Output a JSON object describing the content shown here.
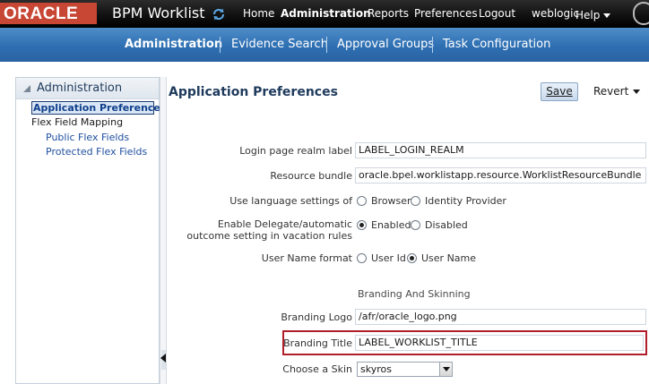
{
  "header": {
    "logo_text": "ORACLE",
    "app_title": "BPM Worklist",
    "refresh_icon": "refresh-icon",
    "nav": [
      "Home",
      "Administration",
      "Reports",
      "Preferences",
      "Logout"
    ],
    "user": "weblogic",
    "help": "Help"
  },
  "tabs": [
    "Administration",
    "Evidence Search",
    "Approval Groups",
    "Task Configuration"
  ],
  "sidebar": {
    "title": "Administration",
    "items": [
      {
        "label": "Application Preferences",
        "selected": true
      },
      {
        "label": "Flex Field Mapping"
      },
      {
        "label": "Public Flex Fields"
      },
      {
        "label": "Protected Flex Fields"
      }
    ]
  },
  "main": {
    "title": "Application Preferences",
    "save_label": "Save",
    "revert_label": "Revert",
    "login_realm": {
      "label": "Login page realm label",
      "value": "LABEL_LOGIN_REALM"
    },
    "resource_bundle": {
      "label": "Resource bundle",
      "value": "oracle.bpel.worklistapp.resource.WorklistResourceBundle"
    },
    "language": {
      "label": "Use language settings of",
      "options": [
        "Browser",
        "Identity Provider"
      ],
      "selected": "Browser"
    },
    "delegate": {
      "label": "Enable Delegate/automatic outcome setting in vacation rules",
      "options": [
        "Enabled",
        "Disabled"
      ],
      "selected": "Enabled"
    },
    "username_format": {
      "label": "User Name format",
      "options": [
        "User Id",
        "User Name"
      ],
      "selected": "User Name"
    },
    "branding_section": "Branding And Skinning",
    "branding_logo": {
      "label": "Branding Logo",
      "value": "/afr/oracle_logo.png"
    },
    "branding_title": {
      "label": "Branding Title",
      "value": "LABEL_WORKLIST_TITLE"
    },
    "skin": {
      "label": "Choose a Skin",
      "value": "skyros"
    }
  },
  "colors": {
    "oracle_red": "#c74634",
    "nav_blue": "#2e6fb2",
    "highlight_red": "#b01e2a"
  }
}
